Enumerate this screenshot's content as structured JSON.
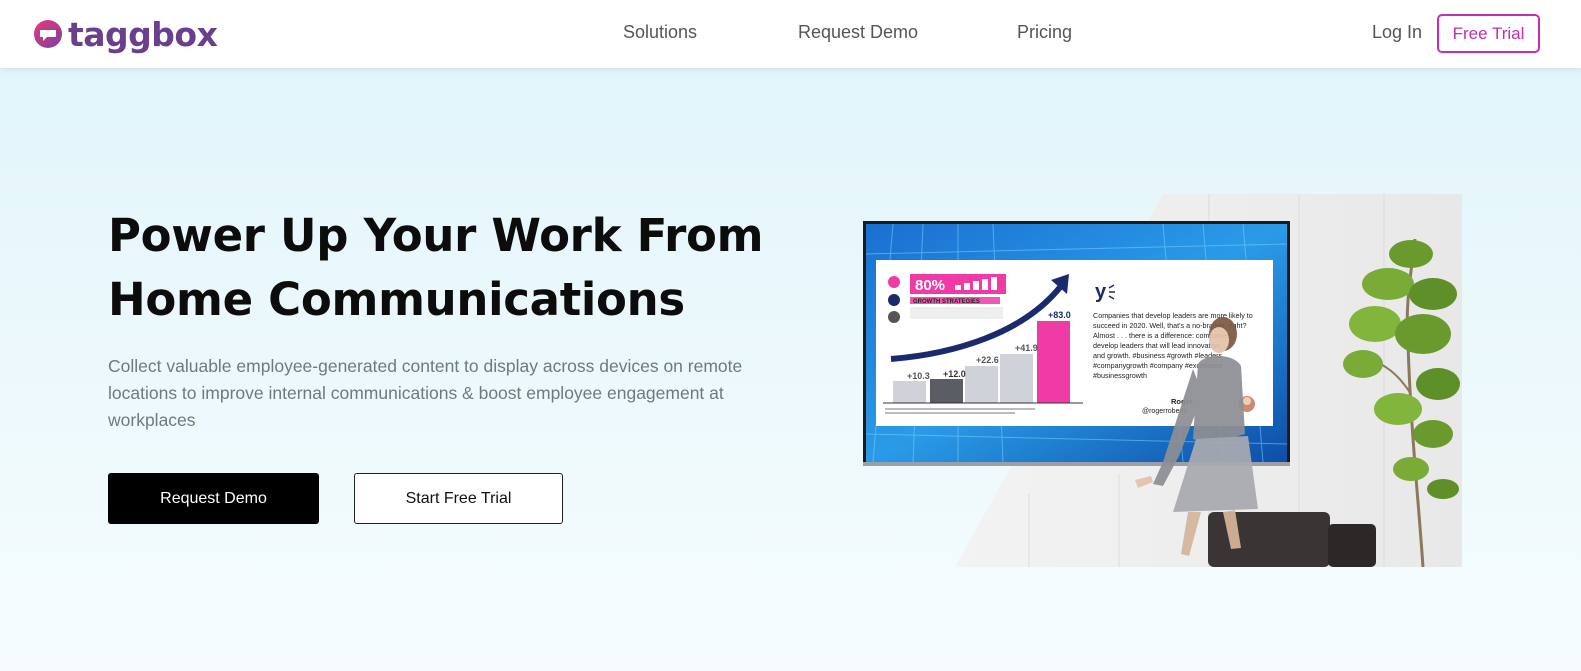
{
  "header": {
    "logo_text": "taggbox",
    "nav": [
      {
        "label": "Solutions"
      },
      {
        "label": "Request Demo"
      },
      {
        "label": "Pricing"
      }
    ],
    "login_label": "Log In",
    "free_trial_label": "Free Trial"
  },
  "hero": {
    "title_line1": "Power Up Your Work From",
    "title_line2": "Home Communications",
    "description": "Collect valuable employee-generated content to display across devices on remote locations to improve internal communications & boost employee engagement at workplaces",
    "primary_button": "Request Demo",
    "secondary_button": "Start Free Trial"
  },
  "screen": {
    "big_percent": "80%",
    "tag_label": "GROWTH STRATEGIES",
    "bar_labels": [
      "+10.3",
      "+12.0",
      "+22.6",
      "+41.9",
      "+83.0"
    ],
    "post_text_lines": [
      "Companies that develop leaders are more likely to",
      "succeed in 2020. Well, that's a no-brainer, right?",
      "Almost . . . there is a difference: companies",
      "develop leaders that will lead innovation",
      "and growth. #business #growth #leaders",
      "#companygrowth #company #excellence",
      "#businessgrowth"
    ],
    "author_name": "Roger",
    "author_handle": "@rogerroberts"
  },
  "colors": {
    "brand_magenta": "#c52eb2",
    "logo_purple": "#6a3f8e",
    "primary_button_bg": "#000000",
    "chart_pink": "#f03aa6"
  }
}
